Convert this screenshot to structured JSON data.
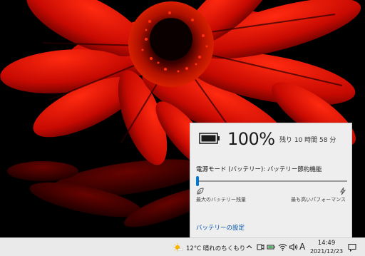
{
  "battery_flyout": {
    "percent": "100%",
    "remaining": "残り 10 時間 58 分",
    "power_mode_label": "電源モード (バッテリー): バッテリー節約機能",
    "power_mode_level": 0,
    "slider_left_label": "最大のバッテリー残量",
    "slider_right_label": "最も高いパフォーマンス",
    "settings_link": "バッテリーの設定"
  },
  "taskbar": {
    "weather": "12°C  晴れのちくもり",
    "ime": "A",
    "time": "14:49",
    "date": "2021/12/23"
  },
  "colors": {
    "accent": "#0078d7",
    "link": "#0050a5",
    "flyout_bg": "#eeeeee",
    "taskbar_bg": "#eaeaea",
    "flower": "#d10d05"
  },
  "icons": [
    "battery-icon",
    "leaf-icon",
    "lightning-icon",
    "weather-sun-icon",
    "chevron-up-icon",
    "meet-now-icon",
    "battery-tray-icon",
    "wifi-icon",
    "volume-icon",
    "notification-icon"
  ]
}
